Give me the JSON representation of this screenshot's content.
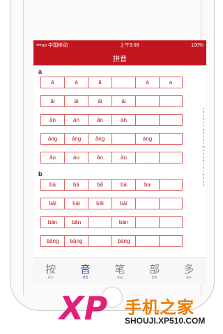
{
  "status_bar": {
    "carrier": "•••oo 中国移动 ",
    "time": "上午9:08",
    "battery": "100%"
  },
  "navbar": {
    "title": "拼音"
  },
  "sections": [
    {
      "letter": "a",
      "rows": [
        [
          "ā",
          "á",
          "ǎ",
          "",
          "à",
          "a"
        ],
        [
          "āi",
          "ái",
          "ǎi",
          "ài",
          "",
          ""
        ],
        [
          "ān",
          "án",
          "ǎn",
          "àn",
          "",
          ""
        ],
        [
          "āng",
          "áng",
          "ǎng",
          "",
          "àng",
          ""
        ],
        [
          "āo",
          "áo",
          "ǎo",
          "ào",
          "",
          ""
        ]
      ]
    },
    {
      "letter": "b",
      "rows": [
        [
          "bā",
          "bá",
          "bǎ",
          "bà",
          "ba",
          ""
        ],
        [
          "bāi",
          "bái",
          "bǎi",
          "bài",
          "",
          ""
        ],
        [
          "bān",
          "bǎn",
          "",
          "bàn",
          "",
          ""
        ],
        [
          "bāng",
          "bǎng",
          "",
          "bàng",
          "",
          ""
        ]
      ]
    }
  ],
  "index_letters": [
    "a",
    "b",
    "c",
    "d",
    "e",
    "f",
    "g",
    "h",
    "j",
    "k",
    "l",
    "m",
    "n",
    "o",
    "p",
    "q",
    "r",
    "s",
    "t",
    "w",
    "x",
    "y",
    "z"
  ],
  "tabs": [
    {
      "glyph": "按",
      "caption": "首页"
    },
    {
      "glyph": "音",
      "caption": "拼音"
    },
    {
      "glyph": "笔",
      "caption": "笔画"
    },
    {
      "glyph": "部",
      "caption": "部首"
    },
    {
      "glyph": "多",
      "caption": "更多"
    }
  ],
  "watermark": {
    "logo": "XP",
    "title": "手机之家",
    "url": "SHOUJI.XP510.COM"
  }
}
